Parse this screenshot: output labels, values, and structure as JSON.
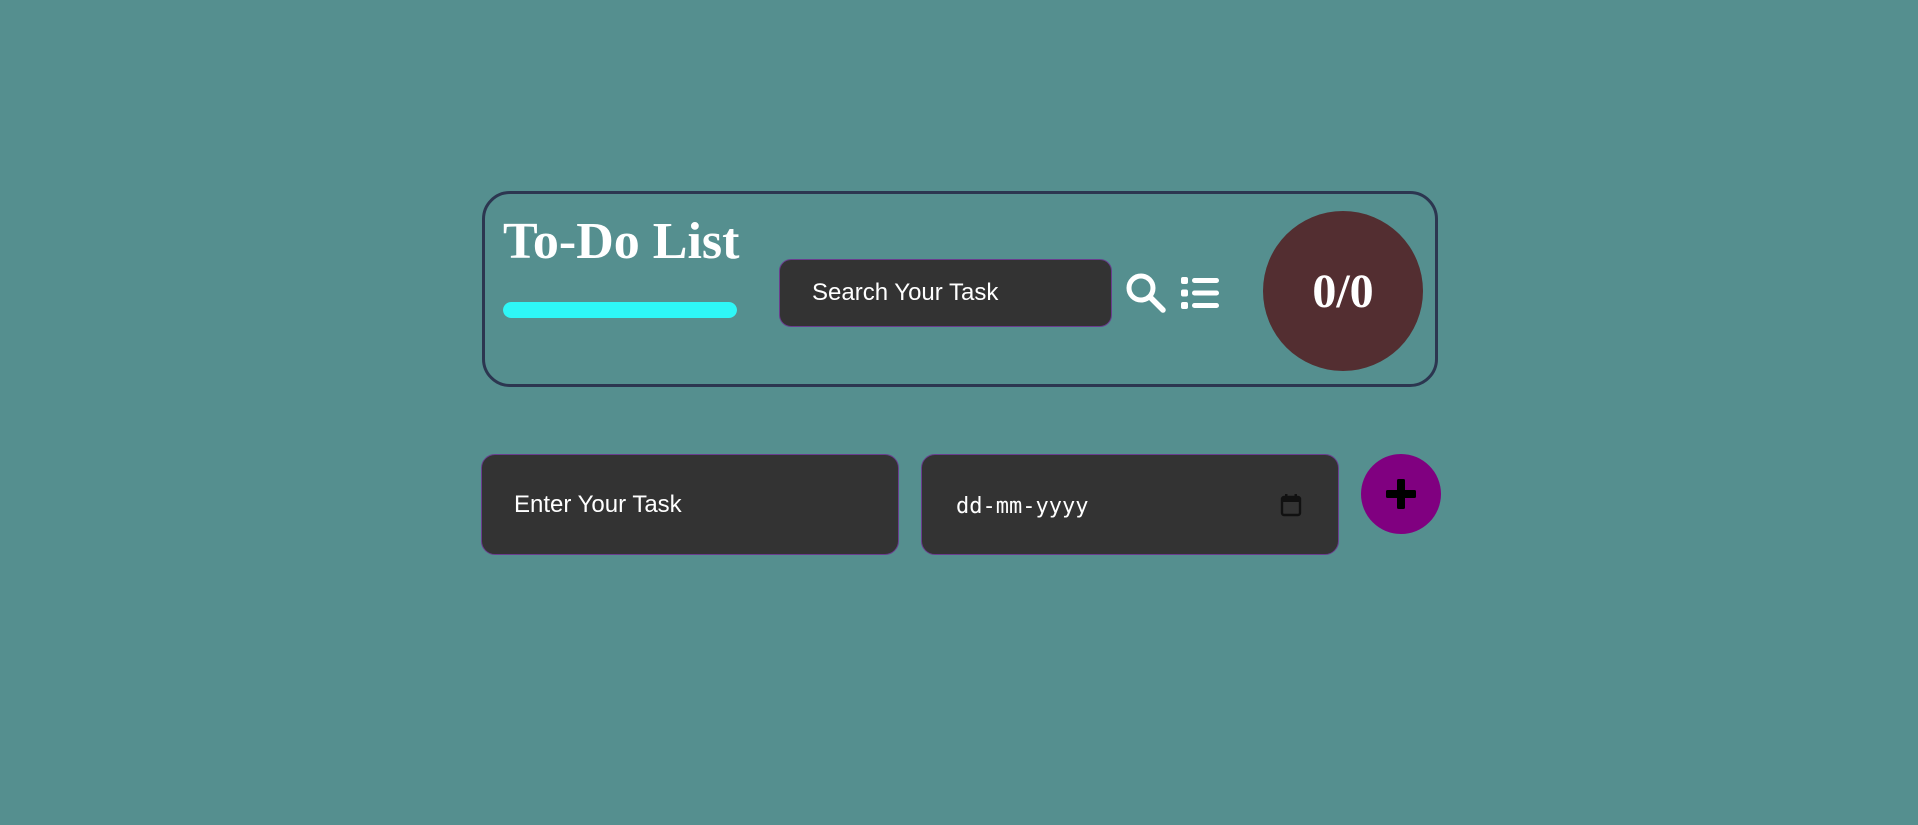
{
  "header": {
    "title": "To-Do List",
    "progress": {
      "fraction": 1.0,
      "color": "#2ef7f7"
    },
    "search": {
      "placeholder": "Search Your Task"
    },
    "icons": {
      "search": "search-icon",
      "list": "list-icon"
    },
    "counter": {
      "text": "0/0",
      "background": "#532e31"
    }
  },
  "form": {
    "task": {
      "placeholder": "Enter Your Task"
    },
    "date": {
      "placeholder": "dd-mm-yyyy",
      "icon": "calendar-icon"
    },
    "add_button": {
      "icon": "plus-icon",
      "background": "#800080"
    }
  },
  "colors": {
    "background": "#558f8f",
    "card_border": "#2c3650",
    "input_background": "#333333",
    "input_border": "#6a3d8e"
  }
}
